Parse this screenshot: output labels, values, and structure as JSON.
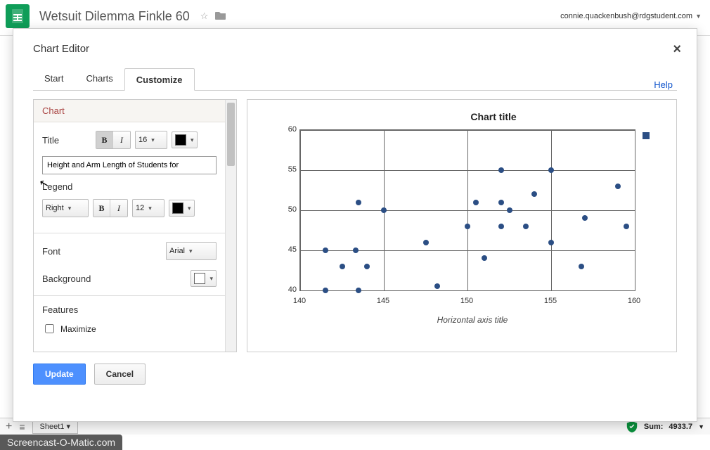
{
  "app": {
    "doc_title": "Wetsuit Dilemma Finkle 60",
    "user_email": "connie.quackenbush@rdgstudent.com"
  },
  "modal": {
    "title": "Chart Editor",
    "help": "Help",
    "tabs": {
      "start": "Start",
      "charts": "Charts",
      "customize": "Customize"
    },
    "footer": {
      "update": "Update",
      "cancel": "Cancel"
    }
  },
  "panel": {
    "section_chart": "Chart",
    "title_label": "Title",
    "title_value": "Height and Arm Length of Students for ",
    "title_size": "16",
    "legend_label": "Legend",
    "legend_pos": "Right",
    "legend_size": "12",
    "font_label": "Font",
    "font_value": "Arial",
    "background_label": "Background",
    "features_label": "Features",
    "maximize_label": "Maximize",
    "bold": "B",
    "italic": "I",
    "colors": {
      "title": "#000000",
      "legend": "#000000",
      "background": "#ffffff"
    }
  },
  "chart_data": {
    "type": "scatter",
    "title": "Chart title",
    "xlabel": "Horizontal axis title",
    "ylabel": "",
    "xlim": [
      140,
      160
    ],
    "ylim": [
      40,
      60
    ],
    "x_ticks": [
      140,
      145,
      150,
      155,
      160
    ],
    "y_ticks": [
      40,
      45,
      50,
      55,
      60
    ],
    "series": [
      {
        "name": "",
        "points": [
          [
            141.5,
            40
          ],
          [
            143.5,
            40
          ],
          [
            142.5,
            43
          ],
          [
            144,
            43
          ],
          [
            156.8,
            43
          ],
          [
            141.5,
            45
          ],
          [
            143.3,
            45
          ],
          [
            151,
            44
          ],
          [
            147.5,
            46
          ],
          [
            148.2,
            40.5
          ],
          [
            155,
            46
          ],
          [
            150,
            48
          ],
          [
            152,
            48
          ],
          [
            153.5,
            48
          ],
          [
            159.5,
            48
          ],
          [
            152.5,
            50
          ],
          [
            157,
            49
          ],
          [
            143.5,
            51
          ],
          [
            145,
            50
          ],
          [
            152,
            51
          ],
          [
            150.5,
            51
          ],
          [
            154,
            52
          ],
          [
            152,
            55
          ],
          [
            155,
            55
          ],
          [
            159,
            53
          ]
        ]
      }
    ]
  },
  "statusbar": {
    "sheet_name": "Sheet1",
    "sum_label": "Sum:",
    "sum_value": "4933.7"
  },
  "watermark": "Screencast-O-Matic.com"
}
